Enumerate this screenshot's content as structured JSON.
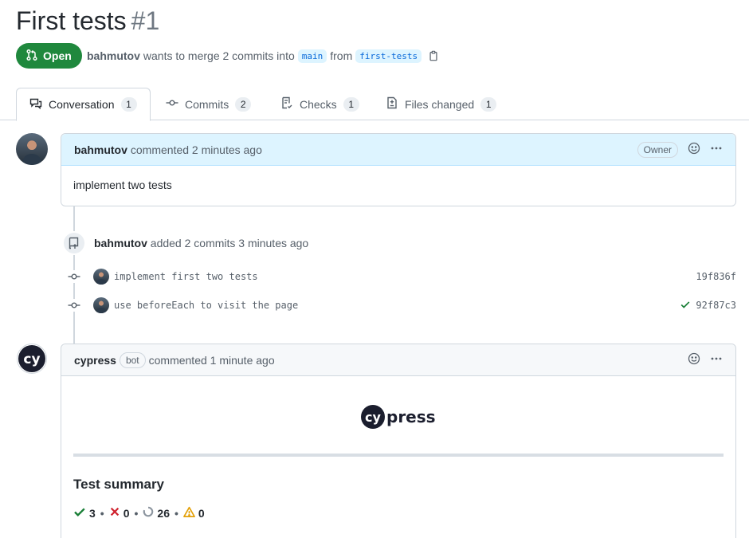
{
  "pr": {
    "title": "First tests",
    "number": "#1",
    "state": "Open",
    "author": "bahmutov",
    "merge_text": "wants to merge 2 commits into",
    "base_branch": "main",
    "from_text": "from",
    "head_branch": "first-tests"
  },
  "tabs": [
    {
      "label": "Conversation",
      "count": "1",
      "icon": "comment-discussion-icon"
    },
    {
      "label": "Commits",
      "count": "2",
      "icon": "git-commit-icon"
    },
    {
      "label": "Checks",
      "count": "1",
      "icon": "checklist-icon"
    },
    {
      "label": "Files changed",
      "count": "1",
      "icon": "file-diff-icon"
    }
  ],
  "comment1": {
    "author": "bahmutov",
    "meta": "commented 2 minutes ago",
    "role": "Owner",
    "body": "implement two tests"
  },
  "event": {
    "author": "bahmutov",
    "text": "added 2 commits 3 minutes ago"
  },
  "commits": [
    {
      "message": "implement first two tests",
      "sha": "19f836f",
      "status": ""
    },
    {
      "message": "use beforeEach to visit the page",
      "sha": "92f87c3",
      "status": "success"
    }
  ],
  "comment2": {
    "author": "cypress",
    "role": "bot",
    "meta": "commented 1 minute ago",
    "logo_text": "cypress",
    "summary_title": "Test summary",
    "passed": "3",
    "failed": "0",
    "skipped": "26",
    "flaky": "0"
  },
  "colors": {
    "open_green": "#1f883d",
    "passed": "#1a7f37",
    "failed": "#cf222e",
    "flaky": "#bf8700",
    "skipped": "#8c959f"
  }
}
